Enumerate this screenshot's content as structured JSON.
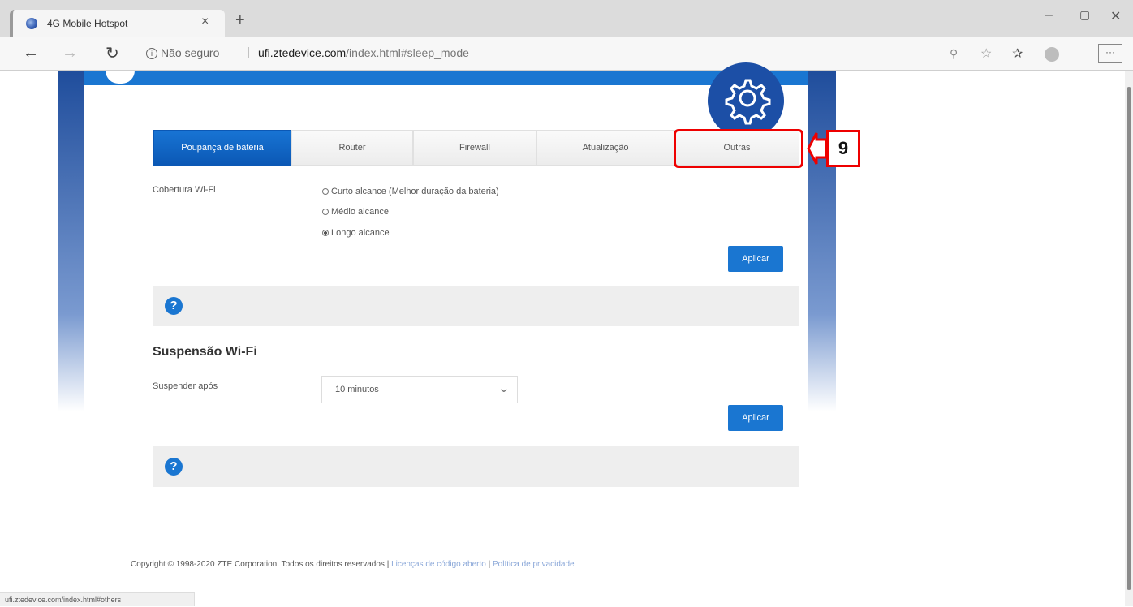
{
  "browser": {
    "tab_title": "4G Mobile Hotspot",
    "tab_close": "×",
    "new_tab": "+",
    "not_secure": "Não seguro",
    "url_host": "ufi.ztedevice.com",
    "url_path": "/index.html#sleep_mode",
    "status_url": "ufi.ztedevice.com/index.html#others"
  },
  "tabs": [
    {
      "label": "Poupança de bateria",
      "active": true
    },
    {
      "label": "Router",
      "active": false
    },
    {
      "label": "Firewall",
      "active": false
    },
    {
      "label": "Atualização",
      "active": false
    },
    {
      "label": "Outras",
      "active": false
    }
  ],
  "wifi_coverage": {
    "label": "Cobertura Wi-Fi",
    "options": [
      {
        "label": "Curto alcance (Melhor duração da bateria)",
        "selected": false
      },
      {
        "label": "Médio alcance",
        "selected": false
      },
      {
        "label": "Longo alcance",
        "selected": true
      }
    ],
    "apply_label": "Aplicar"
  },
  "wifi_sleep": {
    "title": "Suspensão Wi-Fi",
    "label": "Suspender após",
    "selected_value": "10 minutos",
    "apply_label": "Aplicar"
  },
  "footer": {
    "copyright": "Copyright © 1998-2020 ZTE Corporation. Todos os direitos reservados",
    "sep1": "|",
    "licenses": "Licenças de código aberto",
    "sep2": "|",
    "privacy": "Política de privacidade"
  },
  "annotation": {
    "step_number": "9",
    "color": "#ee0000"
  },
  "colors": {
    "primary_blue": "#1a76d1",
    "help_bg": "#eeeeee"
  }
}
